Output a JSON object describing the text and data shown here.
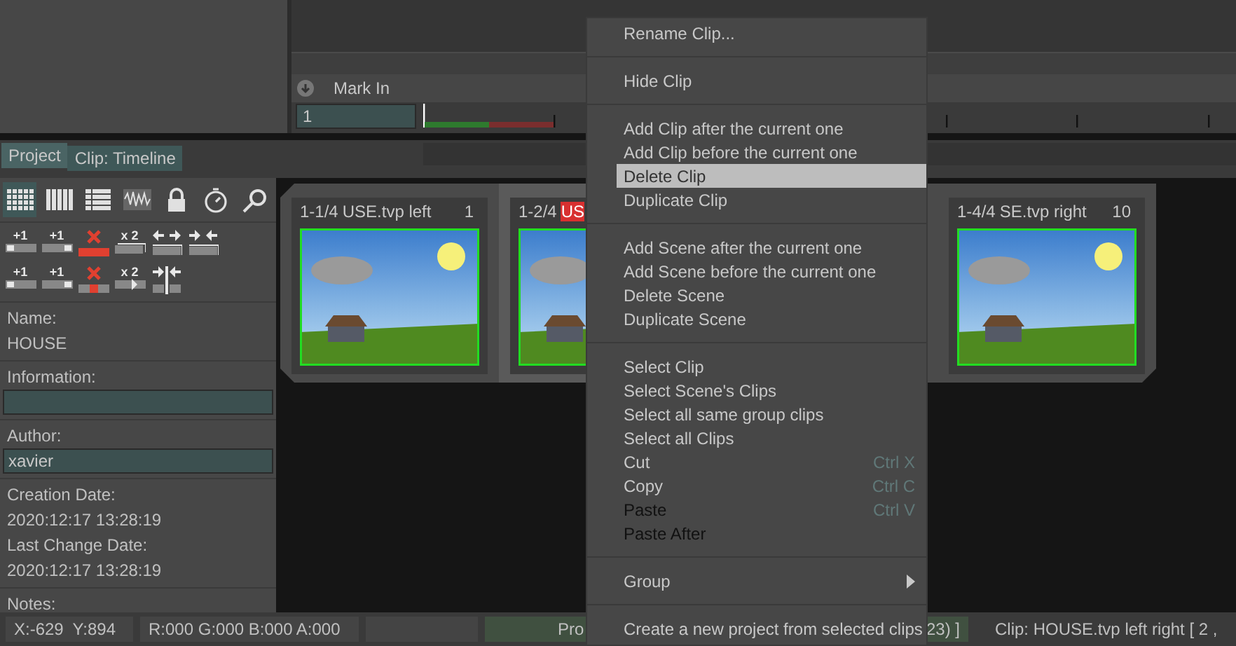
{
  "marker": {
    "label": "Mark In",
    "value": "1"
  },
  "tabs": [
    {
      "label": "Project",
      "selected": true
    },
    {
      "label": "Clip: Timeline",
      "selected": false
    }
  ],
  "toolbar": [
    {
      "kind": "grid",
      "selected": true
    },
    {
      "kind": "columns",
      "selected": false
    },
    {
      "kind": "list",
      "selected": false
    },
    {
      "kind": "wave",
      "selected": false
    },
    {
      "kind": "lock",
      "selected": false
    },
    {
      "kind": "timer",
      "selected": false
    },
    {
      "kind": "search",
      "selected": false
    }
  ],
  "actions": [
    [
      {
        "kind": "bar-left",
        "label": "+1"
      },
      {
        "kind": "bar-right",
        "label": "+1"
      },
      {
        "kind": "delete"
      },
      {
        "kind": "double",
        "label": "x 2"
      },
      {
        "kind": "move-left"
      },
      {
        "kind": "move-right"
      }
    ],
    [
      {
        "kind": "bar-left",
        "label": "+1"
      },
      {
        "kind": "bar-right",
        "label": "+1"
      },
      {
        "kind": "delete-mid"
      },
      {
        "kind": "play",
        "label": "x 2"
      },
      {
        "kind": "split"
      }
    ]
  ],
  "properties": [
    {
      "label": "Name:",
      "kind": "text",
      "value": "HOUSE"
    },
    {
      "label": "Information:",
      "kind": "field"
    },
    {
      "label": "Author:",
      "kind": "field",
      "value": "xavier"
    },
    {
      "label": "Creation Date:",
      "kind": "text",
      "value": "2020:12:17 13:28:19",
      "label2": "Last Change Date:",
      "value2": "2020:12:17 13:28:19"
    },
    {
      "label": "Notes:",
      "kind": "label"
    }
  ],
  "clips": [
    {
      "index": "1-1/4",
      "name": "USE.tvp left",
      "count": "1",
      "selected": false
    },
    {
      "index": "1-2/4",
      "name": "US",
      "selected": true
    },
    {
      "index": "1-4/4",
      "name": "SE.tvp right",
      "count": "10",
      "selected": false
    }
  ],
  "context_menu": [
    [
      {
        "label": "Rename Clip...",
        "selected": false,
        "dimmed": false
      }
    ],
    [
      {
        "label": "Hide Clip",
        "selected": false,
        "dimmed": false
      }
    ],
    [
      {
        "label": "Add Clip after the current one",
        "selected": false,
        "dimmed": false
      },
      {
        "label": "Add Clip before the current one",
        "selected": false,
        "dimmed": false
      },
      {
        "label": "Delete Clip",
        "selected": true,
        "dimmed": false
      },
      {
        "label": "Duplicate Clip",
        "selected": false,
        "dimmed": false
      }
    ],
    [
      {
        "label": "Add Scene after the current one",
        "selected": false,
        "dimmed": false
      },
      {
        "label": "Add Scene before the current one",
        "selected": false,
        "dimmed": false
      },
      {
        "label": "Delete Scene",
        "selected": false,
        "dimmed": false
      },
      {
        "label": "Duplicate Scene",
        "selected": false,
        "dimmed": false
      }
    ],
    [
      {
        "label": "Select Clip",
        "selected": false,
        "dimmed": false
      },
      {
        "label": "Select Scene's Clips",
        "selected": false,
        "dimmed": false
      },
      {
        "label": "Select all same group clips",
        "selected": false,
        "dimmed": false
      },
      {
        "label": "Select all Clips",
        "selected": false,
        "dimmed": false
      },
      {
        "label": "Cut",
        "shortcut": "Ctrl X",
        "selected": false,
        "dimmed": false
      },
      {
        "label": "Copy",
        "shortcut": "Ctrl C",
        "selected": false,
        "dimmed": false
      },
      {
        "label": "Paste",
        "shortcut": "Ctrl V",
        "selected": false,
        "dimmed": true
      },
      {
        "label": "Paste After",
        "selected": false,
        "dimmed": true
      }
    ],
    [
      {
        "label": "Group",
        "submenu": true,
        "selected": false,
        "dimmed": false
      }
    ],
    [
      {
        "label": "Create a new project from selected clips",
        "selected": false,
        "dimmed": false
      }
    ]
  ],
  "status_bar": {
    "position": "X:-629  Y:894",
    "rgba_readout": "R:000 G:000 B:000 A:000",
    "progress_left": "Pro",
    "progress_right": "23) ]",
    "clip": "Clip: HOUSE.tvp left right [ 2 ,"
  }
}
